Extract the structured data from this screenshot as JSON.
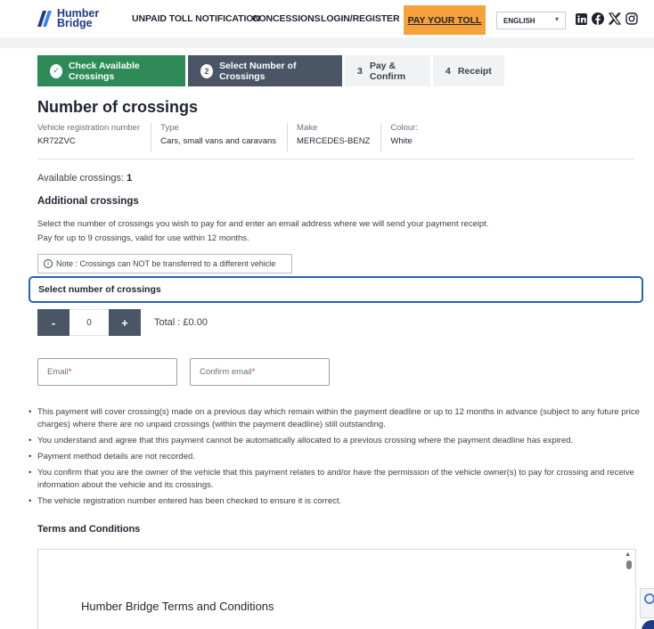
{
  "header": {
    "logo_line1": "Humber",
    "logo_line2": "Bridge",
    "nav": {
      "unpaid": "UNPAID TOLL NOTIFICATION",
      "concessions": "CONCESSIONS",
      "login": "LOGIN/REGISTER"
    },
    "pay_button": "PAY YOUR TOLL",
    "language": "ENGLISH",
    "social": [
      "linkedin-icon",
      "facebook-icon",
      "x-icon",
      "instagram-icon"
    ],
    "colors": {
      "brand_blue": "#1e3a8a",
      "pay_orange": "#f7a13a"
    }
  },
  "steps": [
    {
      "badge": "✓",
      "label": "Check Available Crossings",
      "state": "complete"
    },
    {
      "badge": "2",
      "label": "Select Number of Crossings",
      "state": "active"
    },
    {
      "badge": "3",
      "label": "Pay & Confirm",
      "state": "pending"
    },
    {
      "badge": "4",
      "label": "Receipt",
      "state": "pending"
    }
  ],
  "main": {
    "title": "Number of crossings",
    "vehicle": {
      "reg_label": "Vehicle registration number",
      "reg_value": "KR72ZVC",
      "type_label": "Type",
      "type_value": "Cars, small vans and caravans",
      "make_label": "Make",
      "make_value": "MERCEDES-BENZ",
      "colour_label": "Colour:",
      "colour_value": "White"
    },
    "available_label": "Available crossings:",
    "available_value": "1",
    "additional_heading": "Additional crossings",
    "desc_line1": "Select the number of crossings you wish to pay for and enter an email address where we will send your payment receipt.",
    "desc_line2": "Pay for up to 9 crossings, valid for use within 12 months.",
    "note": "Note : Crossings can NOT be transferred to a different vehicle",
    "select_heading": "Select number of crossings",
    "stepper": {
      "minus": "-",
      "value": "0",
      "plus": "+"
    },
    "total": "Total : £0.00",
    "email_placeholder": "Email",
    "confirm_email_placeholder": "Confirm email",
    "required_mark": "*",
    "bullets": [
      "This payment will cover crossing(s) made on a previous day which remain within the payment deadline or up to 12 months in advance (subject to any future price charges) where there are no unpaid crossings (within the payment deadline) still outstanding.",
      "You understand and agree that this payment cannot be automatically allocated to a previous crossing where the payment deadline has expired.",
      "Payment method details are not recorded.",
      "You confirm that you are the owner of the vehicle that this payment relates to and/or have the permission of the vehicle owner(s) to pay for crossing and receive information about the vehicle and its crossings.",
      "The vehicle registration number entered has been checked to ensure it is correct."
    ],
    "terms_heading": "Terms and Conditions",
    "terms_title": "Humber Bridge Terms and Conditions"
  },
  "colors": {
    "step_complete": "#2e8b57",
    "step_active": "#4a5565",
    "focus_outline": "#2563b8"
  }
}
